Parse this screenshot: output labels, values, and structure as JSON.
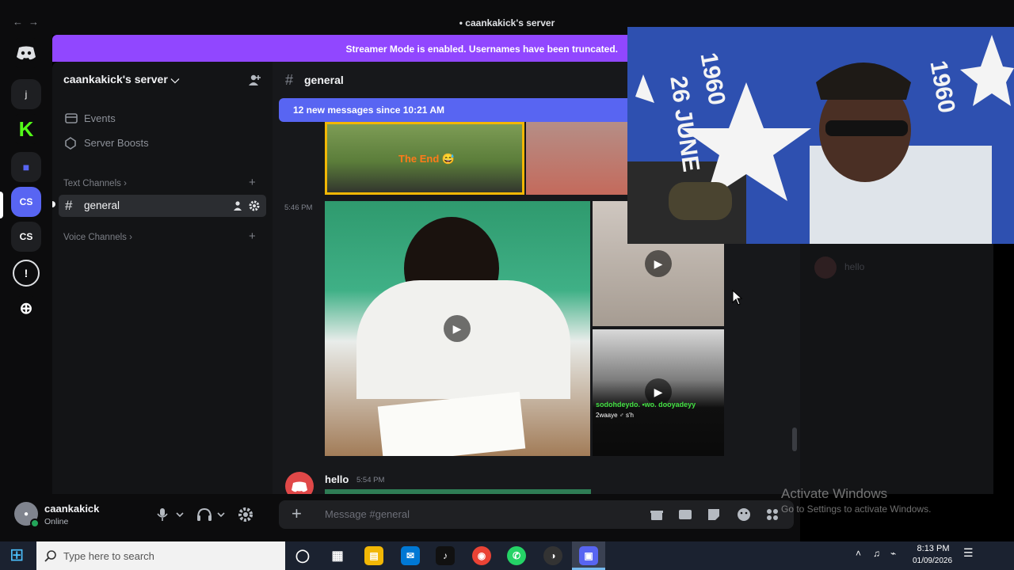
{
  "window": {
    "title": "caankakick's server",
    "back_icon": "←",
    "forward_icon": "→",
    "title_icon": "•",
    "controls": [
      "—",
      "☐",
      "✕"
    ]
  },
  "banner": {
    "text": "Streamer Mode is enabled. Usernames have been truncated."
  },
  "rail": {
    "dm_label": "Direct Messages",
    "servers": [
      {
        "label": "j",
        "color": "#1e1f22"
      },
      {
        "label": "K",
        "color": "#53fc18"
      },
      {
        "label": "■",
        "color": "#1e1f22"
      },
      {
        "label": "CS",
        "color": "#5865f2"
      },
      {
        "label": "CS",
        "color": "#1e1f22"
      }
    ],
    "discover_label": "!",
    "add_label": "⊕"
  },
  "sidebar": {
    "server_name": "caankakick's server ⌵",
    "items": [
      {
        "label": "Events",
        "icon": "calendar-icon"
      },
      {
        "label": "Server Boosts",
        "icon": "boost-icon"
      }
    ],
    "categories": {
      "text": "Text Channels ›",
      "voice": "Voice Channels ›",
      "add": "+"
    },
    "channels": [
      {
        "name": "general",
        "prefix": "#"
      }
    ]
  },
  "chat": {
    "channel_prefix": "#",
    "channel_name": "general",
    "new_messages": "12 new messages since 10:21 AM",
    "sticker_text": "The End 😅",
    "timestamp_1": "5:46 PM",
    "messages": [
      {
        "author": "hello",
        "timestamp": "5:54 PM"
      }
    ],
    "video_caption_1": "sodohdeydo. •wo. dooyadeyy",
    "video_caption_2": "2waaye ♂ s'h"
  },
  "members": {
    "placeholder": "hello"
  },
  "composer": {
    "add_label": "+",
    "placeholder": "Message #general"
  },
  "user": {
    "name": "caankakick",
    "status": "Online",
    "avatar_label": "●"
  },
  "webcam": {
    "flag_text_1": "1960",
    "flag_text_2": "26 JUNE",
    "flag_text_3": "1960"
  },
  "watermark": {
    "title": "Activate Windows",
    "subtitle": "Go to Settings to activate Windows."
  },
  "taskbar": {
    "search_placeholder": "Type here to search",
    "start_icon": "⊞",
    "time": "8:13 PM",
    "date": "01/09/2026",
    "apps": [
      {
        "label": "◯",
        "color": "transparent"
      },
      {
        "label": "▦",
        "color": "transparent"
      },
      {
        "label": "▤",
        "color": "#f2b705"
      },
      {
        "label": "✉",
        "color": "#0078d4"
      },
      {
        "label": "♪",
        "color": "#111111"
      },
      {
        "label": "◉",
        "color": "#ea4335"
      },
      {
        "label": "✆",
        "color": "#25d366"
      },
      {
        "label": "◑",
        "color": "#333333"
      },
      {
        "label": "▣",
        "color": "#5865f2"
      }
    ],
    "tray": [
      "˄",
      "♫",
      "⌁",
      "☰"
    ]
  },
  "colors": {
    "blurple": "#5865f2",
    "streamer_purple": "#9147ff",
    "online_green": "#23a55a"
  }
}
